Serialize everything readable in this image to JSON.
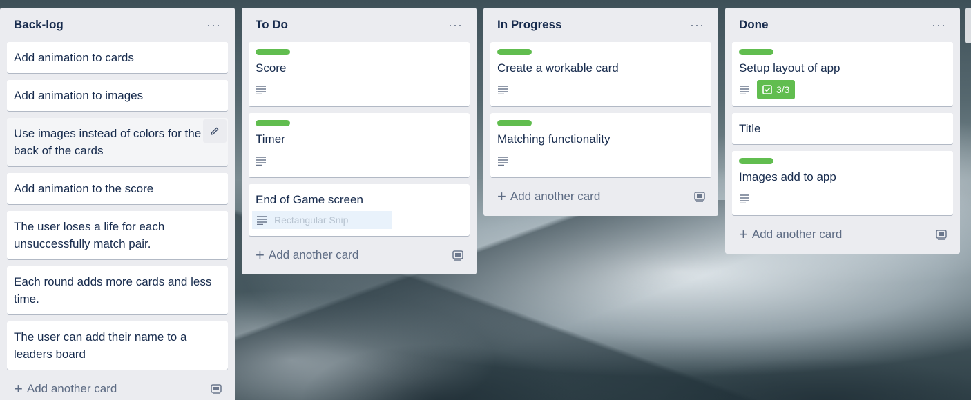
{
  "lists": [
    {
      "title": "Back-log",
      "menu": "···",
      "cards": [
        {
          "title": "Add animation to cards"
        },
        {
          "title": "Add animation to images"
        },
        {
          "title": "Use images instead of colors for the back of the cards",
          "hovered": true
        },
        {
          "title": "Add animation to the score"
        },
        {
          "title": "The user loses a life for each unsuccessfully match pair."
        },
        {
          "title": "Each round adds more cards and less time."
        },
        {
          "title": "The user can add their name to a leaders board"
        }
      ],
      "add_label": "Add another card"
    },
    {
      "title": "To Do",
      "menu": "···",
      "cards": [
        {
          "title": "Score",
          "label_color": "#61bd4f",
          "has_description": true
        },
        {
          "title": "Timer",
          "label_color": "#61bd4f",
          "has_description": true
        },
        {
          "title": "End of Game screen",
          "has_description": true,
          "overlay_text": "Rectangular Snip"
        }
      ],
      "add_label": "Add another card"
    },
    {
      "title": "In Progress",
      "menu": "···",
      "cards": [
        {
          "title": "Create a workable card",
          "label_color": "#61bd4f",
          "has_description": true
        },
        {
          "title": "Matching functionality",
          "label_color": "#61bd4f",
          "has_description": true
        }
      ],
      "add_label": "Add another card"
    },
    {
      "title": "Done",
      "menu": "···",
      "cards": [
        {
          "title": "Setup layout of app",
          "label_color": "#61bd4f",
          "has_description": true,
          "checklist": "3/3"
        },
        {
          "title": "Title"
        },
        {
          "title": "Images add to app",
          "label_color": "#61bd4f",
          "has_description": true
        }
      ],
      "add_label": "Add another card"
    }
  ],
  "icons": {
    "description": "description-lines-icon",
    "checklist": "checklist-icon",
    "edit": "pencil-icon",
    "template": "card-template-icon",
    "plus": "plus-icon"
  },
  "colors": {
    "label_green": "#61bd4f",
    "list_bg": "#ebecf0",
    "text": "#172b4d",
    "muted": "#5e6c84"
  }
}
